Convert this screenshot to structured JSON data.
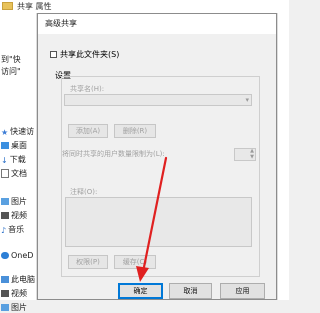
{
  "background": {
    "title": "共享 属性",
    "side_items": [
      {
        "label": "到\"快",
        "top": 0
      },
      {
        "label": "访问\"",
        "top": 0
      },
      {
        "label": "快速访",
        "icon": "star-icon"
      },
      {
        "label": "桌面",
        "icon": "desktop-icon"
      },
      {
        "label": "下载",
        "icon": "download-icon"
      },
      {
        "label": "文档",
        "icon": "document-icon"
      },
      {
        "label": "图片",
        "icon": "picture-icon"
      },
      {
        "label": "视频",
        "icon": "video-icon"
      },
      {
        "label": "音乐",
        "icon": "music-icon"
      },
      {
        "label": "OneD",
        "icon": "cloud-icon"
      },
      {
        "label": "此电脑",
        "icon": "computer-icon"
      },
      {
        "label": "视频",
        "icon": "video-icon"
      },
      {
        "label": "图片",
        "icon": "picture-icon"
      }
    ]
  },
  "dialog": {
    "title": "高级共享",
    "share_checkbox_label": "共享此文件夹(S)",
    "settings_label": "设置",
    "share_name_label": "共享名(H):",
    "add_label": "添加(A)",
    "remove_label": "删除(R)",
    "limit_label": "将同时共享的用户数量限制为(L):",
    "comment_label": "注释(O):",
    "permissions_label": "权限(P)",
    "caching_label": "缓存(C)",
    "ok_label": "确定",
    "cancel_label": "取消",
    "apply_label": "应用"
  },
  "colors": {
    "accent": "#0078d7",
    "annotation": "#e02020"
  }
}
